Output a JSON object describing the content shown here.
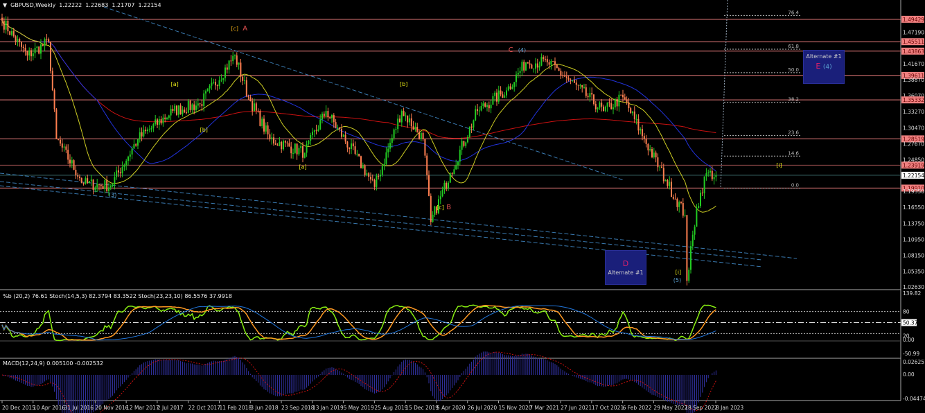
{
  "header": {
    "symbol": "GBPUSD,Weekly",
    "open": "1.22222",
    "high": "1.22683",
    "low": "1.21707",
    "close": "1.22154"
  },
  "indicators": {
    "stoch_label": "%b (20,2) 76.61   Stoch(14,5,3) 82.3794 83.3522   Stoch(23,23,10) 86.5576 37.9918",
    "macd_label": "MACD(12,24,9) 0.005100 -0.002532"
  },
  "colors": {
    "bull": "#22cc22",
    "bear": "#ff7f50",
    "level": "#f08080",
    "current": "#3a6a6a",
    "ma_long": "#cc1111",
    "ma_mid": "#2233dd",
    "ma_short": "#cccc22",
    "stoch_fast": "#88ee11",
    "stoch_slow": "#ff9922",
    "stoch_long": "#2277dd",
    "macd": "#3333aa",
    "signal": "#cc1111"
  },
  "chart_data": {
    "type": "candlestick",
    "title": "GBPUSD,Weekly",
    "x_unit": "weeks since 20 Dec 2015",
    "ylim": [
      1.0263,
      1.51
    ],
    "swing_points": [
      [
        0,
        1.492
      ],
      [
        13,
        1.431
      ],
      [
        24,
        1.455
      ],
      [
        28,
        1.285
      ],
      [
        42,
        1.207
      ],
      [
        56,
        1.203
      ],
      [
        70,
        1.285
      ],
      [
        88,
        1.334
      ],
      [
        102,
        1.346
      ],
      [
        120,
        1.431
      ],
      [
        127,
        1.358
      ],
      [
        138,
        1.285
      ],
      [
        156,
        1.261
      ],
      [
        167,
        1.334
      ],
      [
        188,
        1.225
      ],
      [
        192,
        1.201
      ],
      [
        206,
        1.334
      ],
      [
        217,
        1.285
      ],
      [
        221,
        1.14
      ],
      [
        231,
        1.225
      ],
      [
        245,
        1.334
      ],
      [
        260,
        1.37
      ],
      [
        270,
        1.419
      ],
      [
        281,
        1.419
      ],
      [
        292,
        1.389
      ],
      [
        310,
        1.334
      ],
      [
        320,
        1.358
      ],
      [
        331,
        1.285
      ],
      [
        342,
        1.213
      ],
      [
        352,
        1.152
      ],
      [
        353,
        1.037
      ],
      [
        358,
        1.164
      ],
      [
        363,
        1.225
      ],
      [
        368,
        1.2215
      ]
    ],
    "price_ticks": [
      "1.49429",
      "1.47190",
      "1.45511",
      "1.43863",
      "1.41670",
      "1.39611",
      "1.38870",
      "1.36070",
      "1.35332",
      "1.33270",
      "1.30470",
      "1.28519",
      "1.27670",
      "1.24850",
      "1.23919",
      "1.22154",
      "1.19910",
      "1.19350",
      "1.16550",
      "1.13750",
      "1.10950",
      "1.08150",
      "1.05350",
      "1.02630"
    ],
    "levels": [
      "1.49429",
      "1.45511",
      "1.43863",
      "1.39611",
      "1.35332",
      "1.28519",
      "1.23919",
      "1.19910"
    ],
    "current_price": "1.22154",
    "fib_levels": [
      {
        "label": "76.4",
        "price": 1.501
      },
      {
        "label": "61.8",
        "price": 1.442
      },
      {
        "label": "50.0",
        "price": 1.401
      },
      {
        "label": "38.2",
        "price": 1.349
      },
      {
        "label": "23.6",
        "price": 1.291
      },
      {
        "label": "14.6",
        "price": 1.255
      },
      {
        "label": "0.0",
        "price": 1.199
      }
    ],
    "x_ticks": [
      "20 Dec 2015",
      "10 Apr 2016",
      "31 Jul 2016",
      "20 Nov 2016",
      "12 Mar 2017",
      "2 Jul 2017",
      "22 Oct 2017",
      "11 Feb 2018",
      "3 Jun 2018",
      "23 Sep 2018",
      "13 Jan 2019",
      "5 May 2019",
      "25 Aug 2019",
      "15 Dec 2019",
      "5 Apr 2020",
      "26 Jul 2020",
      "15 Nov 2020",
      "7 Mar 2021",
      "27 Jun 2021",
      "17 Oct 2021",
      "6 Feb 2022",
      "29 May 2022",
      "18 Sep 2022",
      "8 Jan 2023"
    ],
    "wave_labels": [
      {
        "text": "[c]",
        "color": "#e6a817",
        "week": 118,
        "price": 1.475
      },
      {
        "text": "A",
        "color": "#e05050",
        "week": 124,
        "price": 1.475
      },
      {
        "text": "C",
        "color": "#e05050",
        "week": 261,
        "price": 1.437
      },
      {
        "text": "(4)",
        "color": "#5aa0d0",
        "week": 266,
        "price": 1.437
      },
      {
        "text": "[a]",
        "color": "#e6e617",
        "week": 87,
        "price": 1.378
      },
      {
        "text": "[b]",
        "color": "#e6e617",
        "week": 102,
        "price": 1.298
      },
      {
        "text": "[a]",
        "color": "#e6e617",
        "week": 153,
        "price": 1.233
      },
      {
        "text": "[b]",
        "color": "#e6e617",
        "week": 205,
        "price": 1.378
      },
      {
        "text": "[c]",
        "color": "#e6e617",
        "week": 224,
        "price": 1.162
      },
      {
        "text": "B",
        "color": "#e05050",
        "week": 229,
        "price": 1.162
      },
      {
        "text": "(3)",
        "color": "#5aa0d0",
        "week": 55,
        "price": 1.184
      },
      {
        "text": "[i]",
        "color": "#e6e617",
        "week": 399,
        "price": 1.236
      },
      {
        "text": "[i]",
        "color": "#e6e617",
        "week": 347,
        "price": 1.049
      },
      {
        "text": "(5)",
        "color": "#5aa0d0",
        "week": 346,
        "price": 1.035
      }
    ],
    "annotation_boxes": [
      {
        "title": "Alternate #1",
        "wave": "E",
        "degree": "(4)"
      },
      {
        "title": "Alternate #1",
        "wave": "D"
      }
    ],
    "stoch_ticks": [
      "139.82",
      "80",
      "50.37",
      "0.00",
      "20",
      "-50.99"
    ],
    "macd_ticks": [
      "0.026251",
      "0.00",
      "-0.044743"
    ]
  }
}
